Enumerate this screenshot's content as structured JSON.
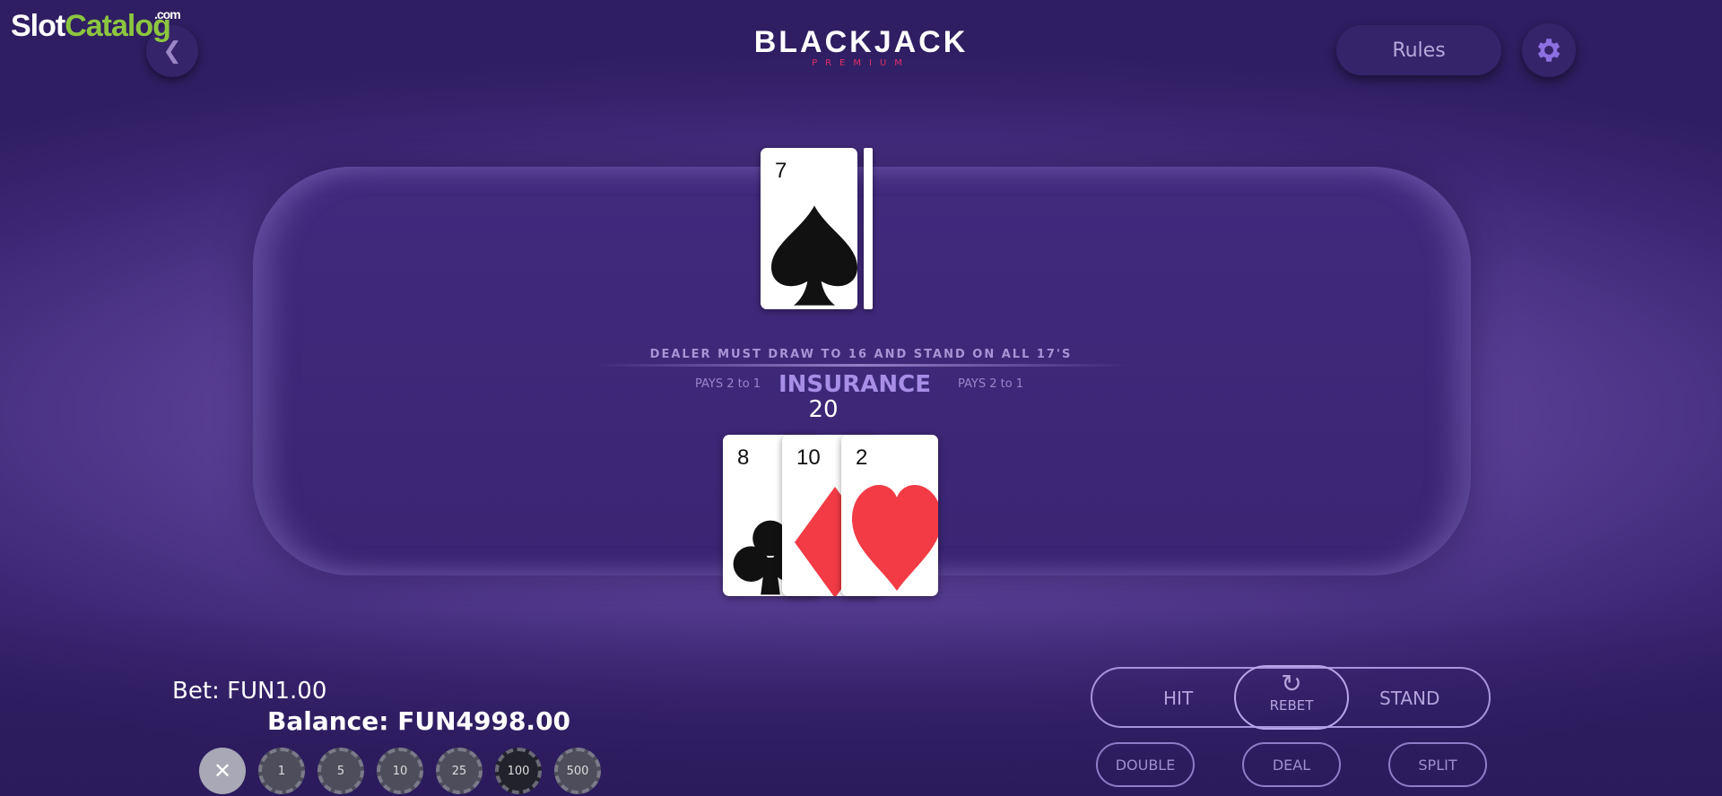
{
  "watermark": {
    "part1": "Slot",
    "part2": "Catalog",
    "suffix": ".com"
  },
  "header": {
    "back_icon": "chevron-left-icon",
    "title": "BLACKJACK",
    "subtitle": "PREMIUM",
    "rules_label": "Rules",
    "settings_icon": "gear-icon"
  },
  "dealer": {
    "cards": [
      {
        "rank": "7",
        "suit": "spades",
        "color": "#111111"
      }
    ],
    "hidden_cards": 1
  },
  "table_text": {
    "rule": "DEALER MUST DRAW TO 16 AND STAND ON ALL 17'S",
    "pays_left": "PAYS 2  to 1",
    "insurance": "INSURANCE",
    "pays_right": "PAYS 2  to 1"
  },
  "player": {
    "total": "20",
    "cards": [
      {
        "rank": "8",
        "suit": "clubs",
        "color": "#111111"
      },
      {
        "rank": "10",
        "suit": "diamonds",
        "color": "#f23b45"
      },
      {
        "rank": "2",
        "suit": "hearts",
        "color": "#f23b45"
      }
    ]
  },
  "status": {
    "bet_label": "Bet:",
    "bet_value": "FUN1.00",
    "balance_label": "Balance:",
    "balance_value": "FUN4998.00"
  },
  "chips": {
    "clear_icon": "close-icon",
    "clear_symbol": "✕",
    "values": [
      "1",
      "5",
      "10",
      "25",
      "100",
      "500"
    ]
  },
  "actions": {
    "hit": "HIT",
    "rebet": "REBET",
    "rebet_icon": "refresh-icon",
    "stand": "STAND",
    "double": "DOUBLE",
    "deal": "DEAL",
    "split": "SPLIT"
  },
  "colors": {
    "accent": "#a88ee6",
    "brand_red": "#e0306a",
    "watermark_green": "#8dc63f"
  }
}
